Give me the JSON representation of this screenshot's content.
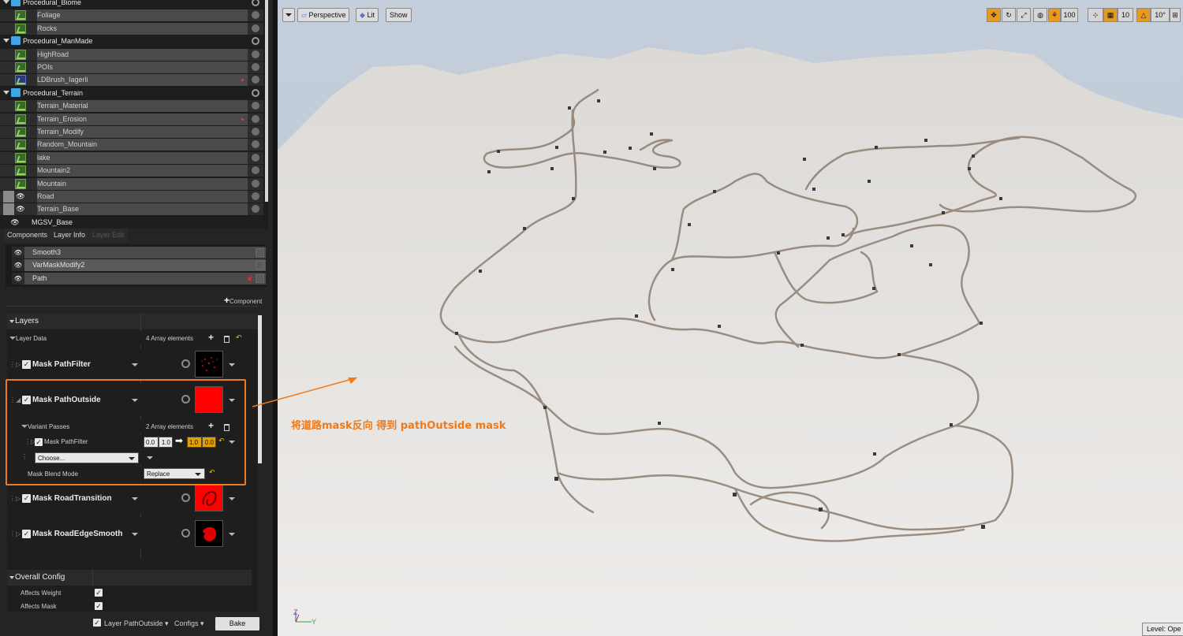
{
  "outliner": {
    "rows": [
      {
        "label": "Procedural_Biome",
        "type": "group"
      },
      {
        "label": "Foliage",
        "type": "item"
      },
      {
        "label": "Rocks",
        "type": "item"
      },
      {
        "label": "Procedural_ManMade",
        "type": "group"
      },
      {
        "label": "HighRoad",
        "type": "item"
      },
      {
        "label": "POIs",
        "type": "item"
      },
      {
        "label": "LDBrush_Iagerli",
        "type": "item-blue"
      },
      {
        "label": "Procedural_Terrain",
        "type": "group"
      },
      {
        "label": "Terrain_Material",
        "type": "item"
      },
      {
        "label": "Terrain_Erosion",
        "type": "item"
      },
      {
        "label": "Terrain_Modify",
        "type": "item"
      },
      {
        "label": "Random_Mountain",
        "type": "item"
      },
      {
        "label": "lake",
        "type": "item"
      },
      {
        "label": "Mountain2",
        "type": "item"
      },
      {
        "label": "Mountain",
        "type": "item"
      },
      {
        "label": "Road",
        "type": "visible"
      },
      {
        "label": "Terrain_Base",
        "type": "visible"
      },
      {
        "label": "MGSV_Base",
        "type": "root"
      }
    ]
  },
  "tabs": {
    "components": "Components",
    "layer_info": "Layer Info",
    "layer_edit": "Layer Edit"
  },
  "components": {
    "items": [
      "Smooth3",
      "VarMaskModify2",
      "Path"
    ],
    "add_label": "Component"
  },
  "layers": {
    "section": "Layers",
    "layer_data": "Layer Data",
    "array_count": "4 Array elements",
    "masks": [
      {
        "name": "Mask PathFilter"
      },
      {
        "name": "Mask PathOutside"
      },
      {
        "name": "Mask RoadTransition"
      },
      {
        "name": "Mask RoadEdgeSmooth"
      }
    ],
    "variant_passes": "Variant Passes",
    "variant_count": "2 Array elements",
    "sub_mask": "Mask PathFilter",
    "range_a": [
      "0.0",
      "1.0"
    ],
    "range_b": [
      "1.0",
      "0.0"
    ],
    "choose": "Choose...",
    "blend_mode_label": "Mask Blend Mode",
    "blend_mode_value": "Replace"
  },
  "overall": {
    "section": "Overall Config",
    "affects_weight": "Affects Weight",
    "affects_mask": "Affects Mask"
  },
  "bottom": {
    "layer": "Layer PathOutside",
    "configs": "Configs",
    "bake": "Bake"
  },
  "viewport": {
    "perspective": "Perspective",
    "lit": "Lit",
    "show": "Show",
    "speed": "100",
    "grid": "10",
    "angle": "10°",
    "level": "Level: Ope",
    "axis_z": "Z",
    "axis_y": "Y",
    "annotation": "将道路mask反向 得到 pathOutside mask"
  },
  "colors": {
    "accent_orange": "#f07a1a",
    "mask_red": "#ff0000"
  }
}
